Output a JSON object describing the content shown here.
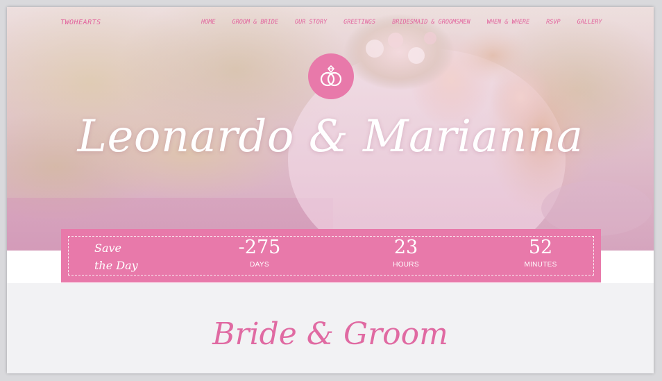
{
  "nav": {
    "brand": "TWOHEARTS",
    "items": [
      {
        "label": "HOME"
      },
      {
        "label": "GROOM & BRIDE"
      },
      {
        "label": "OUR STORY"
      },
      {
        "label": "GREETINGS"
      },
      {
        "label": "BRIDESMAID & GROOMSMEN"
      },
      {
        "label": "WHEN & WHERE"
      },
      {
        "label": "RSVP"
      },
      {
        "label": "GALLERY"
      }
    ]
  },
  "hero": {
    "emblem_icon": "wedding-rings-icon",
    "names": "Leonardo & Marianna"
  },
  "countdown": {
    "save_line1": "Save",
    "save_line2": "the Day",
    "days_value": "-275",
    "days_label": "DAYS",
    "hours_value": "23",
    "hours_label": "HOURS",
    "minutes_value": "52",
    "minutes_label": "MINUTES"
  },
  "section": {
    "title": "Bride & Groom"
  },
  "colors": {
    "accent": "#e879aa",
    "accent_text": "#e2639d",
    "section_bg": "#f2f2f4"
  }
}
